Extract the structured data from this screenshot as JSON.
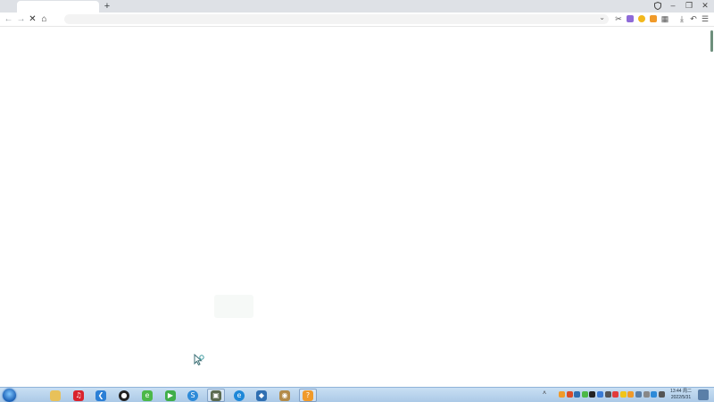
{
  "browser": {
    "tabs": [
      {
        "title": ""
      }
    ],
    "new_tab_label": "+",
    "window_controls": {
      "minimize": "–",
      "restore": "❐",
      "close": "✕"
    },
    "nav": {
      "back": "←",
      "forward": "→",
      "stop": "✕",
      "home": "⌂"
    },
    "address_bar": {
      "value": "",
      "dropdown": "⌄"
    },
    "toolbar_icons": {
      "cut": "✂",
      "download": "⤓",
      "undo": "↶",
      "menu": "☰",
      "apps": "▦"
    },
    "colors": {
      "ext_purple": "#8e6bd8",
      "ext_yellow": "#f2b81c",
      "ext_orange": "#f09a2a",
      "tab_strip": "#dee1e6"
    }
  },
  "taskbar": {
    "clock_time": "13:44 周二",
    "clock_date": "2022/5/31",
    "apps": [
      {
        "name": "file-explorer-icon",
        "color": "#e8c15a",
        "glyph": ""
      },
      {
        "name": "netease-music-icon",
        "color": "#d9232d",
        "glyph": "♫"
      },
      {
        "name": "vscode-icon",
        "color": "#2b7fd6",
        "glyph": "❮"
      },
      {
        "name": "obs-icon",
        "color": "#222222",
        "glyph": "●"
      },
      {
        "name": "green-app-icon",
        "color": "#4cb848",
        "glyph": "e"
      },
      {
        "name": "media-player-icon",
        "color": "#3fae49",
        "glyph": "▶"
      },
      {
        "name": "browser-app-icon",
        "color": "#2d8ad8",
        "glyph": "S"
      },
      {
        "name": "game-app-icon",
        "color": "#5b6a4f",
        "glyph": "▣"
      },
      {
        "name": "edge-browser-icon",
        "color": "#1e88d8",
        "glyph": "e"
      },
      {
        "name": "network-app-icon",
        "color": "#2f6fb2",
        "glyph": "◆"
      },
      {
        "name": "owl-app-icon",
        "color": "#b38b4a",
        "glyph": "◉"
      },
      {
        "name": "help-app-icon",
        "color": "#f09a2a",
        "glyph": "?"
      }
    ],
    "tray_colors": [
      "#f09a2a",
      "#d94c2a",
      "#2f6fb2",
      "#4cb848",
      "#222222",
      "#3a7bd5",
      "#555555",
      "#e23b3b",
      "#f0c419",
      "#f09a2a",
      "#5a7fa8",
      "#888888",
      "#2d8ad8",
      "#555555"
    ]
  }
}
